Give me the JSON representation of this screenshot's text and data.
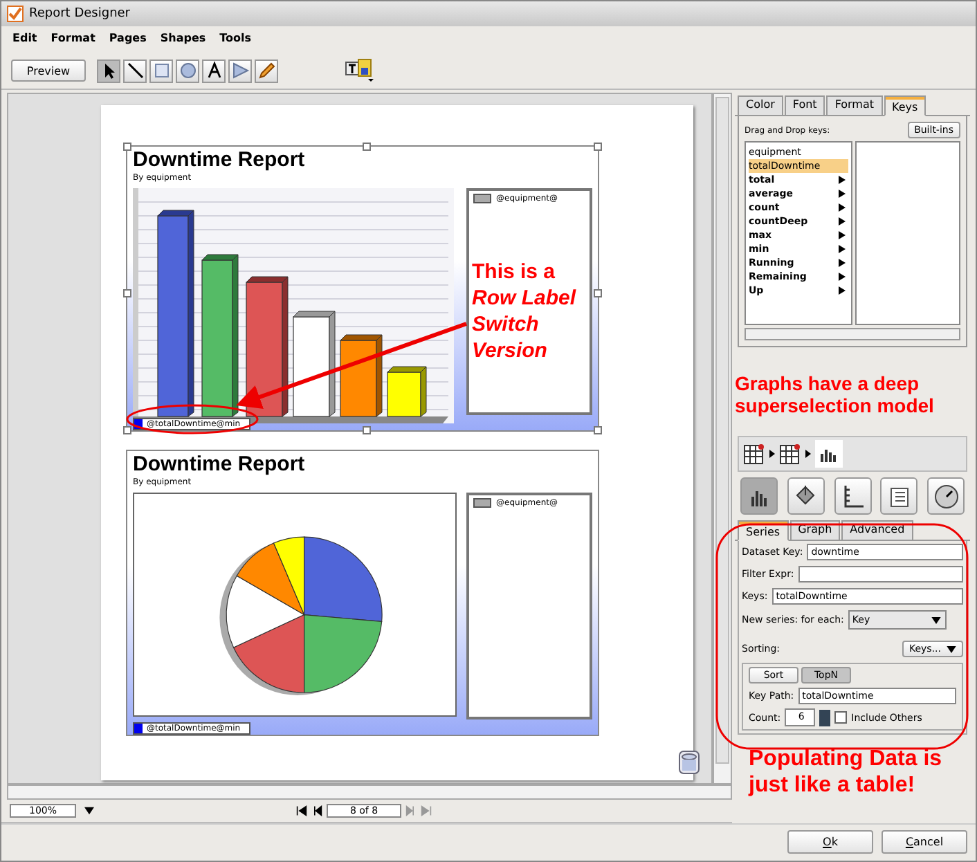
{
  "window": {
    "title": "Report Designer"
  },
  "menu": [
    "Edit",
    "Format",
    "Pages",
    "Shapes",
    "Tools"
  ],
  "toolbar": {
    "preview_button": "Preview",
    "tools": [
      {
        "kind": "pointer",
        "selected": true
      },
      {
        "kind": "line",
        "selected": false
      },
      {
        "kind": "rect",
        "selected": false
      },
      {
        "kind": "oval",
        "selected": false
      },
      {
        "kind": "text",
        "selected": false
      },
      {
        "kind": "polygon",
        "selected": false
      },
      {
        "kind": "pencil",
        "selected": false
      }
    ]
  },
  "reports": [
    {
      "title": "Downtime Report",
      "subtitle": "By equipment",
      "legend_label": "@equipment@",
      "series_label": "@totalDowntime@min"
    },
    {
      "title": "Downtime Report",
      "subtitle": "By equipment",
      "legend_label": "@equipment@",
      "series_label": "@totalDowntime@min"
    }
  ],
  "chart_callout": "This is a *Row Label Switch Version*",
  "status_bar": {
    "zoom": "100%",
    "page": "8 of 8"
  },
  "side_tabs": [
    {
      "label": "Color",
      "selected": false
    },
    {
      "label": "Font",
      "selected": false
    },
    {
      "label": "Format",
      "selected": false
    },
    {
      "label": "Keys",
      "selected": true
    }
  ],
  "keys": {
    "heading": "Drag and Drop keys:",
    "builtins_button": "Built-ins",
    "items": [
      {
        "label": "equipment",
        "selected": false,
        "has_submenu": false
      },
      {
        "label": "totalDowntime",
        "selected": true,
        "has_submenu": false
      },
      {
        "label": "total",
        "selected": false,
        "has_submenu": true
      },
      {
        "label": "average",
        "selected": false,
        "has_submenu": true
      },
      {
        "label": "count",
        "selected": false,
        "has_submenu": true
      },
      {
        "label": "countDeep",
        "selected": false,
        "has_submenu": true
      },
      {
        "label": "max",
        "selected": false,
        "has_submenu": true
      },
      {
        "label": "min",
        "selected": false,
        "has_submenu": true
      },
      {
        "label": "Running",
        "selected": false,
        "has_submenu": true
      },
      {
        "label": "Remaining",
        "selected": false,
        "has_submenu": true
      },
      {
        "label": "Up",
        "selected": false,
        "has_submenu": true
      }
    ]
  },
  "graphs_note": "Graphs have a deep superselection model",
  "chart_types": [
    {
      "kind": "bar",
      "selected": true
    },
    {
      "kind": "bucket",
      "selected": false
    },
    {
      "kind": "axis",
      "selected": false
    },
    {
      "kind": "list",
      "selected": false
    },
    {
      "kind": "gauge",
      "selected": false
    }
  ],
  "series_tabs": [
    {
      "label": "Series",
      "selected": true
    },
    {
      "label": "Graph",
      "selected": false
    },
    {
      "label": "Advanced",
      "selected": false
    }
  ],
  "fields": [
    {
      "label": "Dataset Key:",
      "value": "downtime"
    },
    {
      "label": "Filter Expr:"
    },
    {
      "label": "Keys:",
      "value": "totalDowntime"
    }
  ],
  "new_series": {
    "label": "New series: for each:",
    "value": "Key"
  },
  "sorting": {
    "label": "Sorting:",
    "keys_button": "Keys...",
    "modes": [
      {
        "label": "Sort",
        "selected": false
      },
      {
        "label": "TopN",
        "selected": true
      }
    ],
    "key_path": {
      "label": "Key Path:",
      "value": "totalDowntime"
    },
    "count": {
      "label": "Count:",
      "value": "6"
    },
    "include_others": {
      "label": "Include Others",
      "checked": false
    }
  },
  "populating_note": "Populating Data is just like a table!",
  "buttons": [
    "Ok",
    "Cancel"
  ]
}
